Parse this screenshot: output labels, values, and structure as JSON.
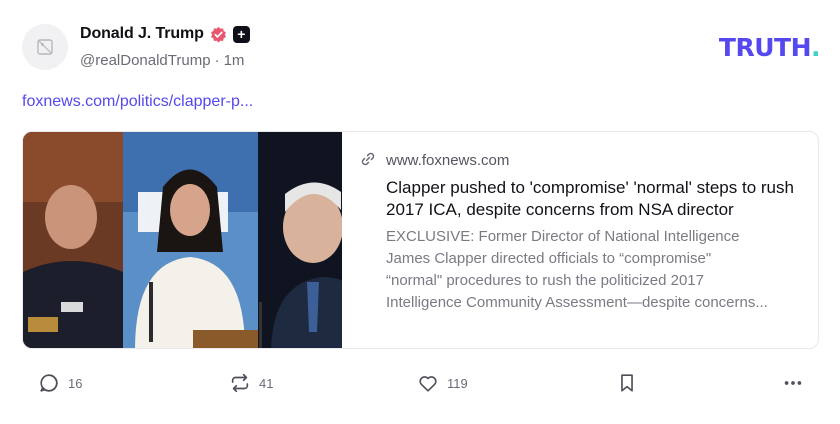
{
  "post": {
    "author": {
      "display_name": "Donald J. Trump",
      "handle": "@realDonaldTrump",
      "separator": "·",
      "time": "1m",
      "avatar_icon": "image-placeholder-icon",
      "badges": [
        "verified-badge-icon",
        "plus-badge-icon"
      ]
    },
    "link_text": "foxnews.com/politics/clapper-p...",
    "card": {
      "domain": "www.foxnews.com",
      "title": "Clapper pushed to 'compromise' 'normal' steps to rush 2017 ICA, despite concerns from NSA director",
      "description_lines": [
        "EXCLUSIVE: Former Director of National Intelligence",
        "James Clapper directed officials to “compromise\"",
        "“normal\" procedures to rush the politicized 2017",
        "Intelligence Community Assessment—despite concerns..."
      ]
    },
    "actions": {
      "replies": "16",
      "retruths": "41",
      "likes": "119"
    }
  },
  "brand": {
    "logo_text": "TRUTH",
    "logo_dot": ".",
    "accent_color": "#5448ee",
    "dot_color": "#3fd0c8",
    "verified_color": "#e8576f"
  }
}
